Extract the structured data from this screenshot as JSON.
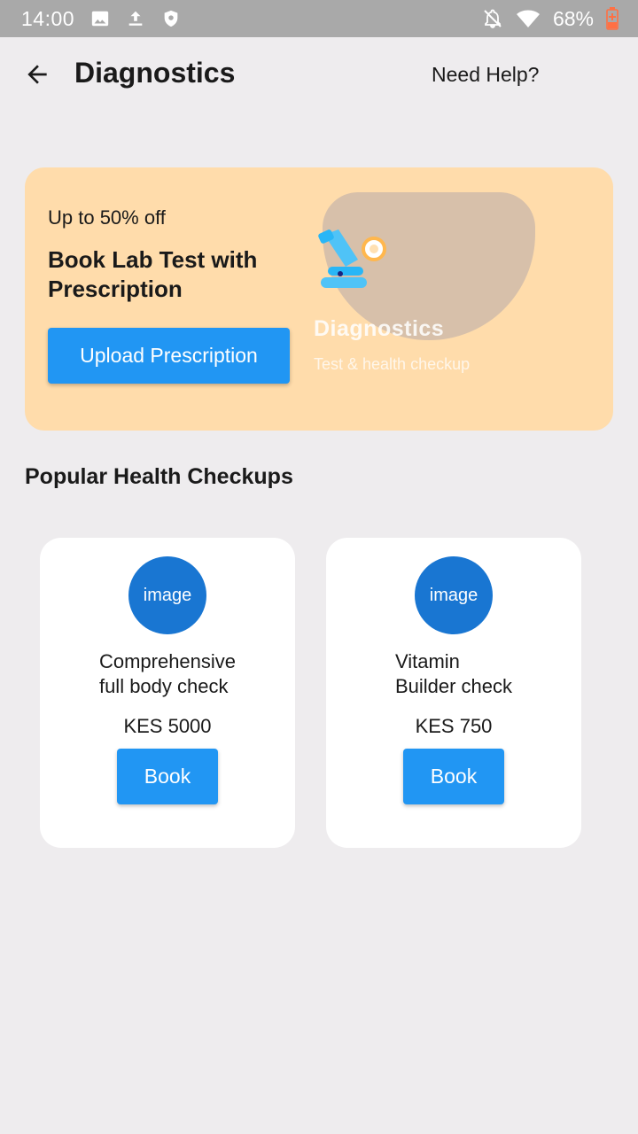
{
  "status_bar": {
    "time": "14:00",
    "battery": "68%",
    "icons_left": [
      "image-icon",
      "upload-icon",
      "shield-icon"
    ],
    "icons_right": [
      "notifications-off-icon",
      "wifi-icon",
      "battery-charging-icon"
    ]
  },
  "app_bar": {
    "title": "Diagnostics",
    "help_label": "Need Help?"
  },
  "promo": {
    "discount": "Up to 50% off",
    "heading": "Book Lab Test with Prescription",
    "button_label": "Upload Prescription",
    "art_brand": "Diagnostics",
    "art_tagline": "Test & health checkup"
  },
  "section": {
    "title": "Popular Health Checkups"
  },
  "checkups": [
    {
      "image_label": "image",
      "name": "Comprehensive\nfull body check",
      "price": "KES 5000",
      "button_label": "Book"
    },
    {
      "image_label": "image",
      "name": "Vitamin\nBuilder check",
      "price": "KES 750",
      "button_label": "Book"
    }
  ],
  "colors": {
    "primary": "#2196f3",
    "image_circle": "#1976d2",
    "promo_bg": "#ffdcab",
    "page_bg": "#eeecee",
    "status_bar_bg": "#a9a9a9"
  }
}
